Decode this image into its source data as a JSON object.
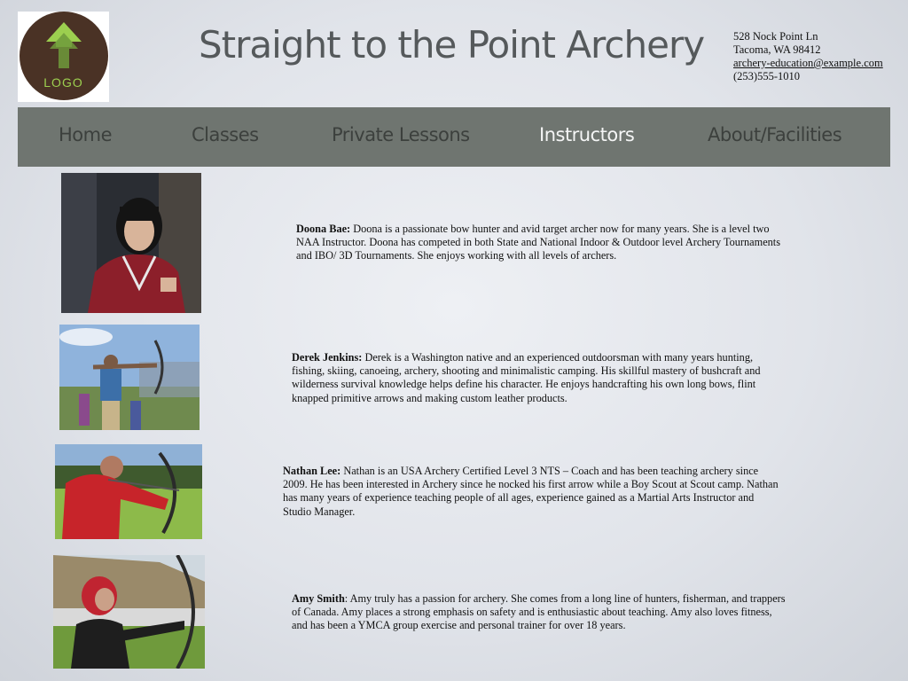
{
  "header": {
    "logo_text": "LOGO",
    "title": "Straight to the Point Archery",
    "contact": {
      "street": "528 Nock Point Ln",
      "city": "Tacoma, WA 98412",
      "email": "archery-education@example.com",
      "phone": "(253)555-1010"
    }
  },
  "nav": {
    "items": [
      {
        "label": "Home"
      },
      {
        "label": "Classes"
      },
      {
        "label": "Private Lessons"
      },
      {
        "label": "Instructors"
      },
      {
        "label": "About/Facilities"
      }
    ],
    "active": "Instructors"
  },
  "instructors": [
    {
      "name": "Doona Bae:",
      "bio": " Doona is a passionate bow hunter and avid target archer now for many years. She is a level two NAA Instructor. Doona has competed in both State and National Indoor & Outdoor level Archery Tournaments and IBO/ 3D Tournaments. She enjoys working with all levels of archers."
    },
    {
      "name": "Derek Jenkins:",
      "bio": " Derek is a Washington native and an experienced outdoorsman with many years hunting, fishing, skiing, canoeing, archery, shooting and minimalistic camping. His skillful mastery of bushcraft and wilderness survival knowledge helps define his character. He enjoys handcrafting his own long bows, flint knapped primitive arrows and making custom leather products."
    },
    {
      "name": "Nathan Lee:",
      "bio": " Nathan is an USA Archery Certified Level 3 NTS – Coach and has been teaching archery since 2009. He has been interested in Archery since he nocked his first arrow while a Boy Scout at Scout camp. Nathan has many years of experience teaching people of all ages, experience gained as a Martial Arts Instructor and Studio Manager."
    },
    {
      "name": "Amy Smith",
      "bio": ": Amy truly has a passion for archery. She comes from a long line of hunters, fisherman, and trappers of Canada. Amy  places a strong emphasis on safety and is enthusiastic about teaching. Amy also loves fitness, and has been a YMCA group exercise and personal trainer for over 18 years."
    }
  ],
  "colors": {
    "nav_bg": "#6f7570",
    "nav_text": "#3c403d",
    "nav_active_text": "#f4f5f5",
    "title_text": "#55595b",
    "logo_disc": "#4a3225",
    "logo_accent": "#9ccf4f"
  }
}
